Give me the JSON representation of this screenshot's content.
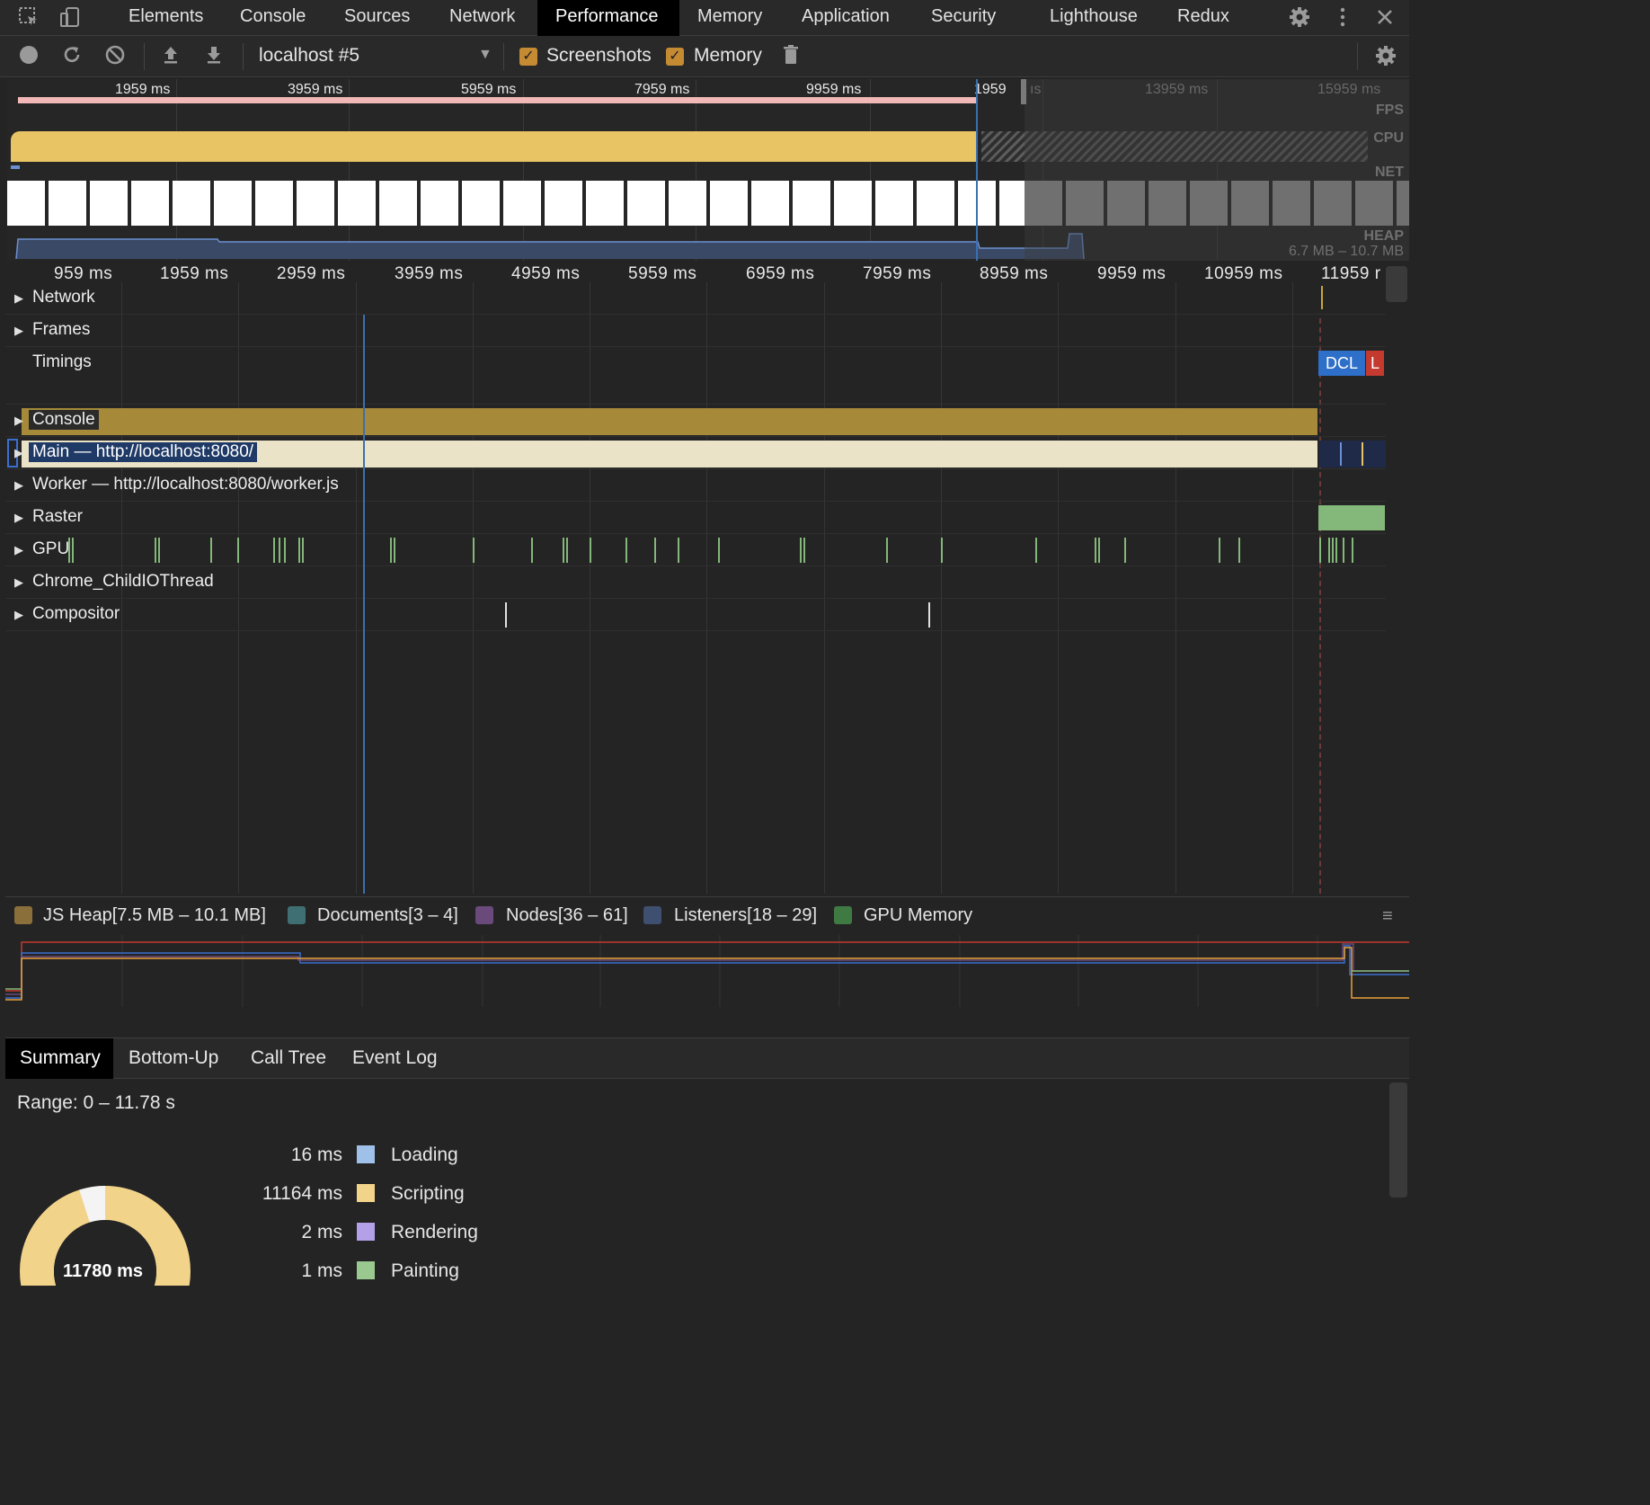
{
  "tabs": {
    "items": [
      "Elements",
      "Console",
      "Sources",
      "Network",
      "Performance",
      "Memory",
      "Application",
      "Security",
      "Lighthouse",
      "Redux"
    ],
    "active": "Performance"
  },
  "toolbar": {
    "profile_select": "localhost #5",
    "screenshots_label": "Screenshots",
    "memory_label": "Memory"
  },
  "overview": {
    "ticks": [
      "1959 ms",
      "3959 ms",
      "5959 ms",
      "7959 ms",
      "9959 ms",
      "1959",
      "ıs",
      "13959 ms",
      "15959 ms"
    ],
    "labels": {
      "fps": "FPS",
      "cpu": "CPU",
      "net": "NET",
      "heap": "HEAP"
    },
    "heap_range": "6.7 MB – 10.7 MB"
  },
  "ruler": {
    "ticks": [
      "959 ms",
      "1959 ms",
      "2959 ms",
      "3959 ms",
      "4959 ms",
      "5959 ms",
      "6959 ms",
      "7959 ms",
      "8959 ms",
      "9959 ms",
      "10959 ms",
      "11959 r"
    ]
  },
  "tracks": {
    "network": "Network",
    "frames": "Frames",
    "timings": "Timings",
    "dcl": "DCL",
    "l": "L",
    "console": "Console",
    "main": "Main — http://localhost:8080/",
    "worker": "Worker — http://localhost:8080/worker.js",
    "raster": "Raster",
    "gpu": "GPU",
    "childio": "Chrome_ChildIOThread",
    "compositor": "Compositor"
  },
  "counters": {
    "js_heap": "JS Heap[7.5 MB – 10.1 MB]",
    "documents": "Documents[3 – 4]",
    "nodes": "Nodes[36 – 61]",
    "listeners": "Listeners[18 – 29]",
    "gpu_memory": "GPU Memory",
    "colors": {
      "js_heap": "#8a6f3a",
      "documents": "#3f6f73",
      "nodes": "#6a4a7a",
      "listeners": "#3e4f70",
      "gpu_memory": "#3f7a43"
    }
  },
  "bottom_tabs": {
    "items": [
      "Summary",
      "Bottom-Up",
      "Call Tree",
      "Event Log"
    ],
    "active": "Summary"
  },
  "summary": {
    "range": "Range: 0 – 11.78 s",
    "total": "11780 ms",
    "rows": [
      {
        "value": "16 ms",
        "label": "Loading",
        "color": "#9fc0e8"
      },
      {
        "value": "11164 ms",
        "label": "Scripting",
        "color": "#f2d38a"
      },
      {
        "value": "2 ms",
        "label": "Rendering",
        "color": "#b3a0e6"
      },
      {
        "value": "1 ms",
        "label": "Painting",
        "color": "#99c98f"
      }
    ]
  }
}
